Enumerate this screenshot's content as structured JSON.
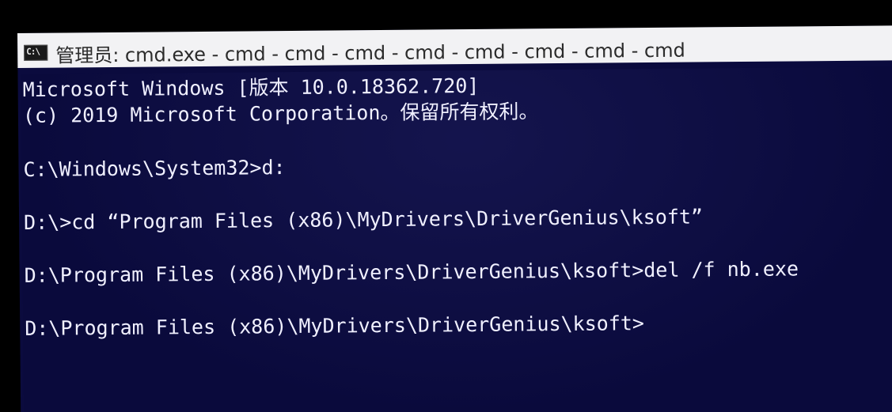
{
  "window": {
    "title": "管理员: cmd.exe - cmd - cmd - cmd - cmd - cmd - cmd - cmd - cmd",
    "icon": "cmd-icon",
    "icon_label": "C:\\"
  },
  "console": {
    "lines": [
      "Microsoft Windows [版本 10.0.18362.720]",
      "(c) 2019 Microsoft Corporation。保留所有权利。",
      "C:\\Windows\\System32>d:",
      "D:\\>cd “Program Files (x86)\\MyDrivers\\DriverGenius\\ksoft”",
      "D:\\Program Files (x86)\\MyDrivers\\DriverGenius\\ksoft>del /f nb.exe",
      "D:\\Program Files (x86)\\MyDrivers\\DriverGenius\\ksoft>"
    ]
  },
  "colors": {
    "console_background": "#0a0a3c",
    "console_text": "#f0f0ff",
    "titlebar_background": "#f2f2f4"
  }
}
